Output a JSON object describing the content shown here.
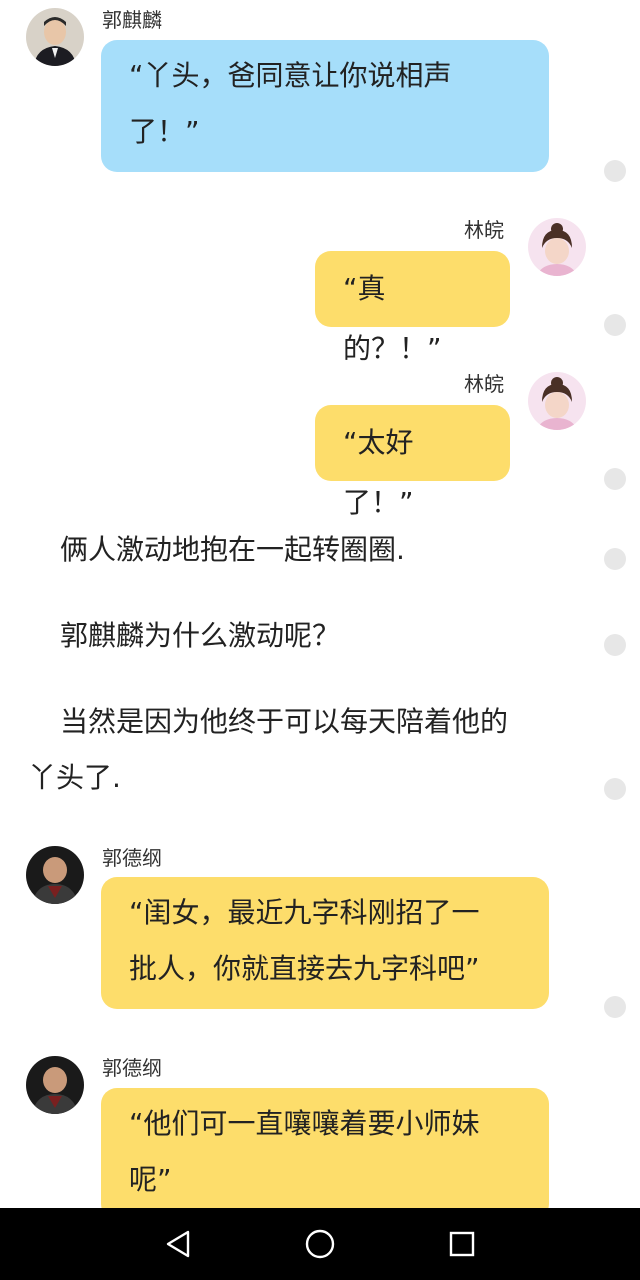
{
  "messages": [
    {
      "sender": "郭麒麟",
      "text": "“丫头，爸同意让你说相声\n了！”",
      "avatar_icon": "man-in-suit-avatar"
    },
    {
      "sender": "林皖",
      "text": "“真的？！”",
      "avatar_icon": "girl-pink-avatar"
    },
    {
      "sender": "林皖",
      "text": "“太好了！”",
      "avatar_icon": "girl-pink-avatar"
    },
    {
      "sender": "郭德纲",
      "text": "“闺女，最近九字科刚招了一\n批人，你就直接去九字科吧”",
      "avatar_icon": "older-man-avatar"
    },
    {
      "sender": "郭德纲",
      "text": "“他们可一直嚷嚷着要小师妹\n呢”",
      "avatar_icon": "older-man-avatar"
    }
  ],
  "narration": [
    "　俩人激动地抱在一起转圈圈.",
    "　郭麒麟为什么激动呢？",
    "　当然是因为他终于可以每天陪着他的",
    "丫头了."
  ],
  "colors": {
    "blue_bubble": "#a6defa",
    "yellow_bubble": "#fddd6b",
    "navbar": "#000000"
  },
  "navbar": {
    "back_icon": "triangle-back-icon",
    "home_icon": "circle-home-icon",
    "recents_icon": "square-recents-icon"
  }
}
